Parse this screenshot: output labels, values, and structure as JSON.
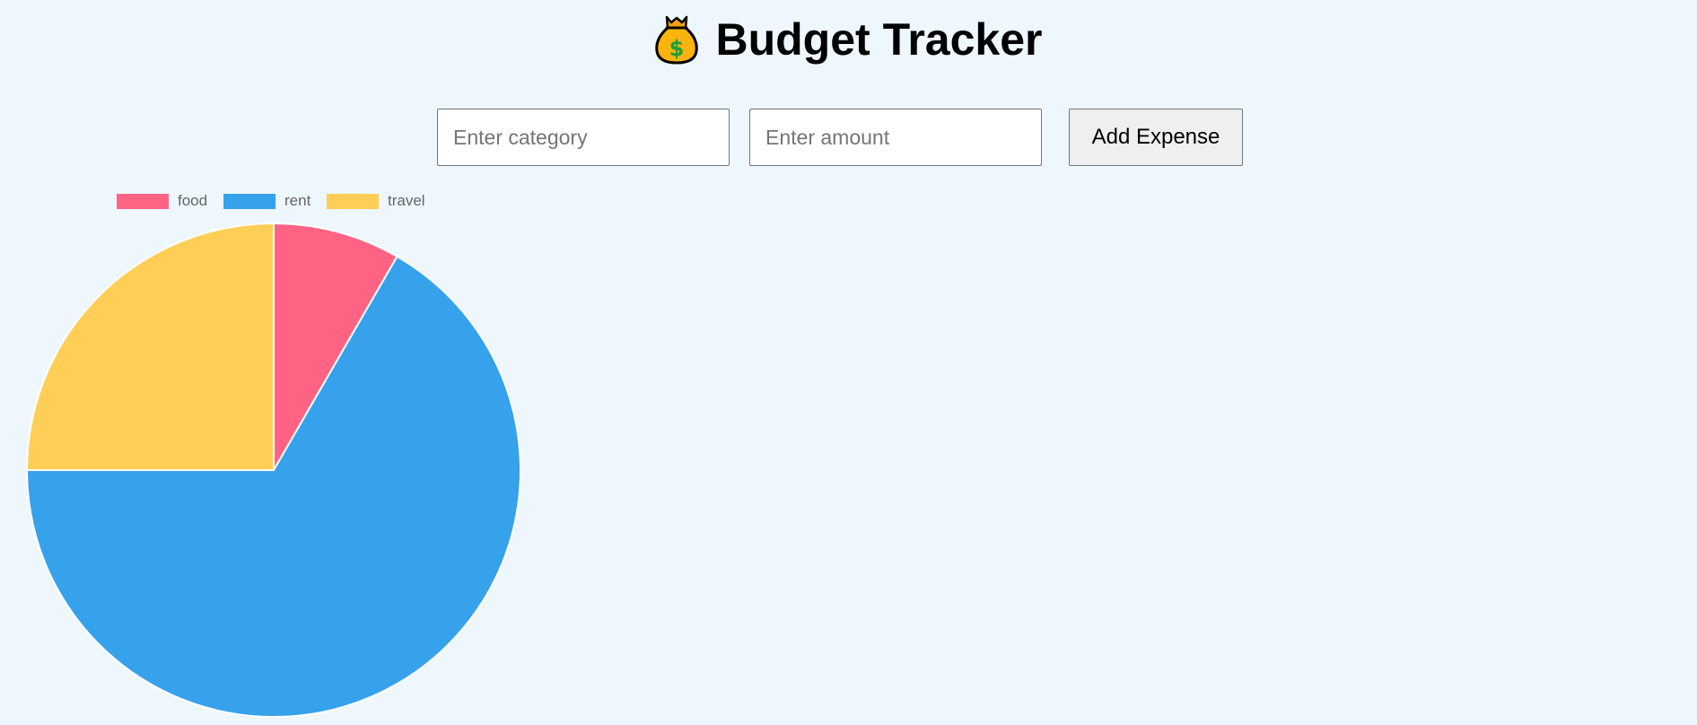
{
  "header": {
    "icon": "money-bag-icon",
    "title": "Budget Tracker"
  },
  "form": {
    "category_placeholder": "Enter category",
    "category_value": "",
    "amount_placeholder": "Enter amount",
    "amount_value": "",
    "add_label": "Add Expense"
  },
  "colors": {
    "background": "#eef7fd",
    "food": "#ff6384",
    "rent": "#36a2eb",
    "travel": "#ffce56"
  },
  "chart_data": {
    "type": "pie",
    "title": "",
    "legend_position": "top",
    "categories": [
      "food",
      "rent",
      "travel"
    ],
    "values": [
      50,
      400,
      150
    ],
    "colors": [
      "#ff6384",
      "#36a2eb",
      "#ffce56"
    ]
  }
}
